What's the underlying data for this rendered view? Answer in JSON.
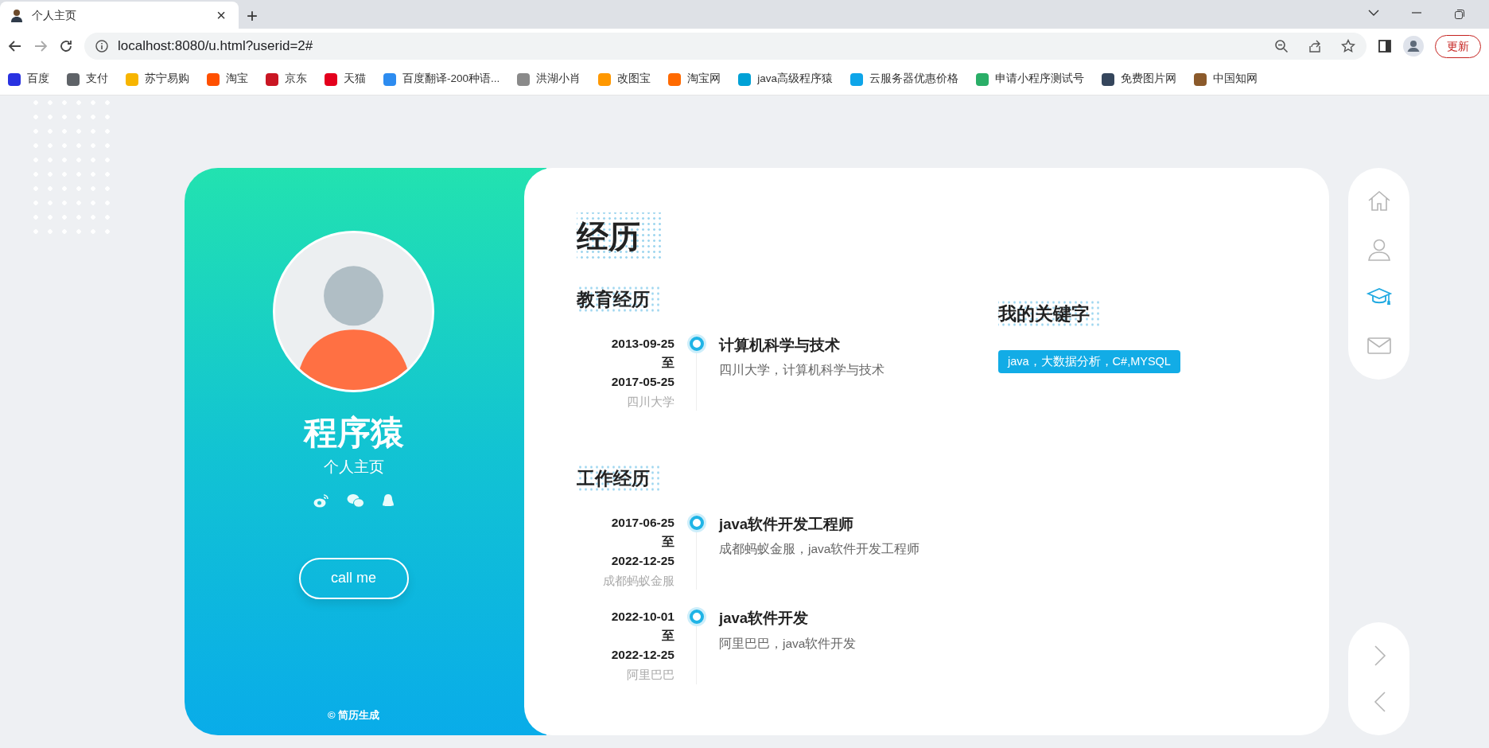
{
  "browser": {
    "tab_title": "个人主页",
    "new_tab": "+",
    "close": "×",
    "url": "localhost:8080/u.html?userid=2#",
    "update_button": "更新",
    "bookmarks": [
      {
        "label": "百度",
        "color": "#2932e1"
      },
      {
        "label": "支付",
        "color": "#5f6368"
      },
      {
        "label": "苏宁易购",
        "color": "#f7b500"
      },
      {
        "label": "淘宝",
        "color": "#ff5000"
      },
      {
        "label": "京东",
        "color": "#c91623"
      },
      {
        "label": "天猫",
        "color": "#e4001d"
      },
      {
        "label": "百度翻译-200种语...",
        "color": "#2d8cf0"
      },
      {
        "label": "洪湖小肖",
        "color": "#8a8a8a"
      },
      {
        "label": "改图宝",
        "color": "#ff9800"
      },
      {
        "label": "淘宝网",
        "color": "#ff6a00"
      },
      {
        "label": "java高级程序猿",
        "color": "#00a1d6"
      },
      {
        "label": "云服务器优惠价格",
        "color": "#0ea5e9"
      },
      {
        "label": "申请小程序测试号",
        "color": "#2aae67"
      },
      {
        "label": "免费图片网",
        "color": "#35465c"
      },
      {
        "label": "中国知网",
        "color": "#8b5a2b"
      }
    ]
  },
  "profile": {
    "name": "程序猿",
    "subtitle": "个人主页",
    "button": "call me",
    "footer": "© 简历生成"
  },
  "resume": {
    "title": "经历",
    "sections": [
      {
        "title": "教育经历",
        "entries": [
          {
            "start": "2013-09-25",
            "separator": "至",
            "end": "2017-05-25",
            "org": "四川大学",
            "title": "计算机科学与技术",
            "description": "四川大学，计算机科学与技术"
          }
        ]
      },
      {
        "title": "工作经历",
        "entries": [
          {
            "start": "2017-06-25",
            "separator": "至",
            "end": "2022-12-25",
            "org": "成都蚂蚁金服",
            "title": "java软件开发工程师",
            "description": "成都蚂蚁金服，java软件开发工程师"
          },
          {
            "start": "2022-10-01",
            "separator": "至",
            "end": "2022-12-25",
            "org": "阿里巴巴",
            "title": "java软件开发",
            "description": "阿里巴巴，java软件开发"
          }
        ]
      }
    ],
    "keywords": {
      "title": "我的关键字",
      "tags": [
        "java，大数据分析，C#,MYSQL"
      ]
    }
  },
  "nav": [
    {
      "kind": "home",
      "selected": false
    },
    {
      "kind": "user",
      "selected": false
    },
    {
      "kind": "education",
      "selected": true
    },
    {
      "kind": "mail",
      "selected": false
    }
  ],
  "pager": [
    {
      "kind": "next"
    },
    {
      "kind": "prev"
    }
  ]
}
